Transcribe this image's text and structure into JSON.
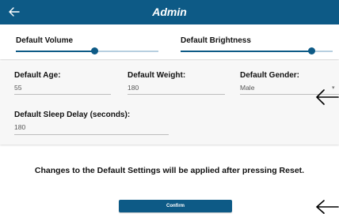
{
  "colors": {
    "brand": "#0d5a86",
    "track": "#b7cfe0",
    "background": "#f7f7f7"
  },
  "appbar": {
    "title": "Admin",
    "back_icon": "arrow-left-icon"
  },
  "sliders": {
    "volume": {
      "label": "Default Volume",
      "value_fraction": 0.55
    },
    "brightness": {
      "label": "Default Brightness",
      "value_fraction": 0.86
    }
  },
  "fields": {
    "age": {
      "label": "Default Age:",
      "value": "55"
    },
    "weight": {
      "label": "Default Weight:",
      "value": "180"
    },
    "gender": {
      "label": "Default Gender:",
      "value": "Male"
    },
    "sleep_delay": {
      "label": "Default Sleep Delay (seconds):",
      "value": "180"
    }
  },
  "notice": "Changes to the Default Settings will be applied after pressing Reset.",
  "confirm_label": "Confirm",
  "annotations": [
    "arrow-left-icon",
    "arrow-left-icon"
  ]
}
